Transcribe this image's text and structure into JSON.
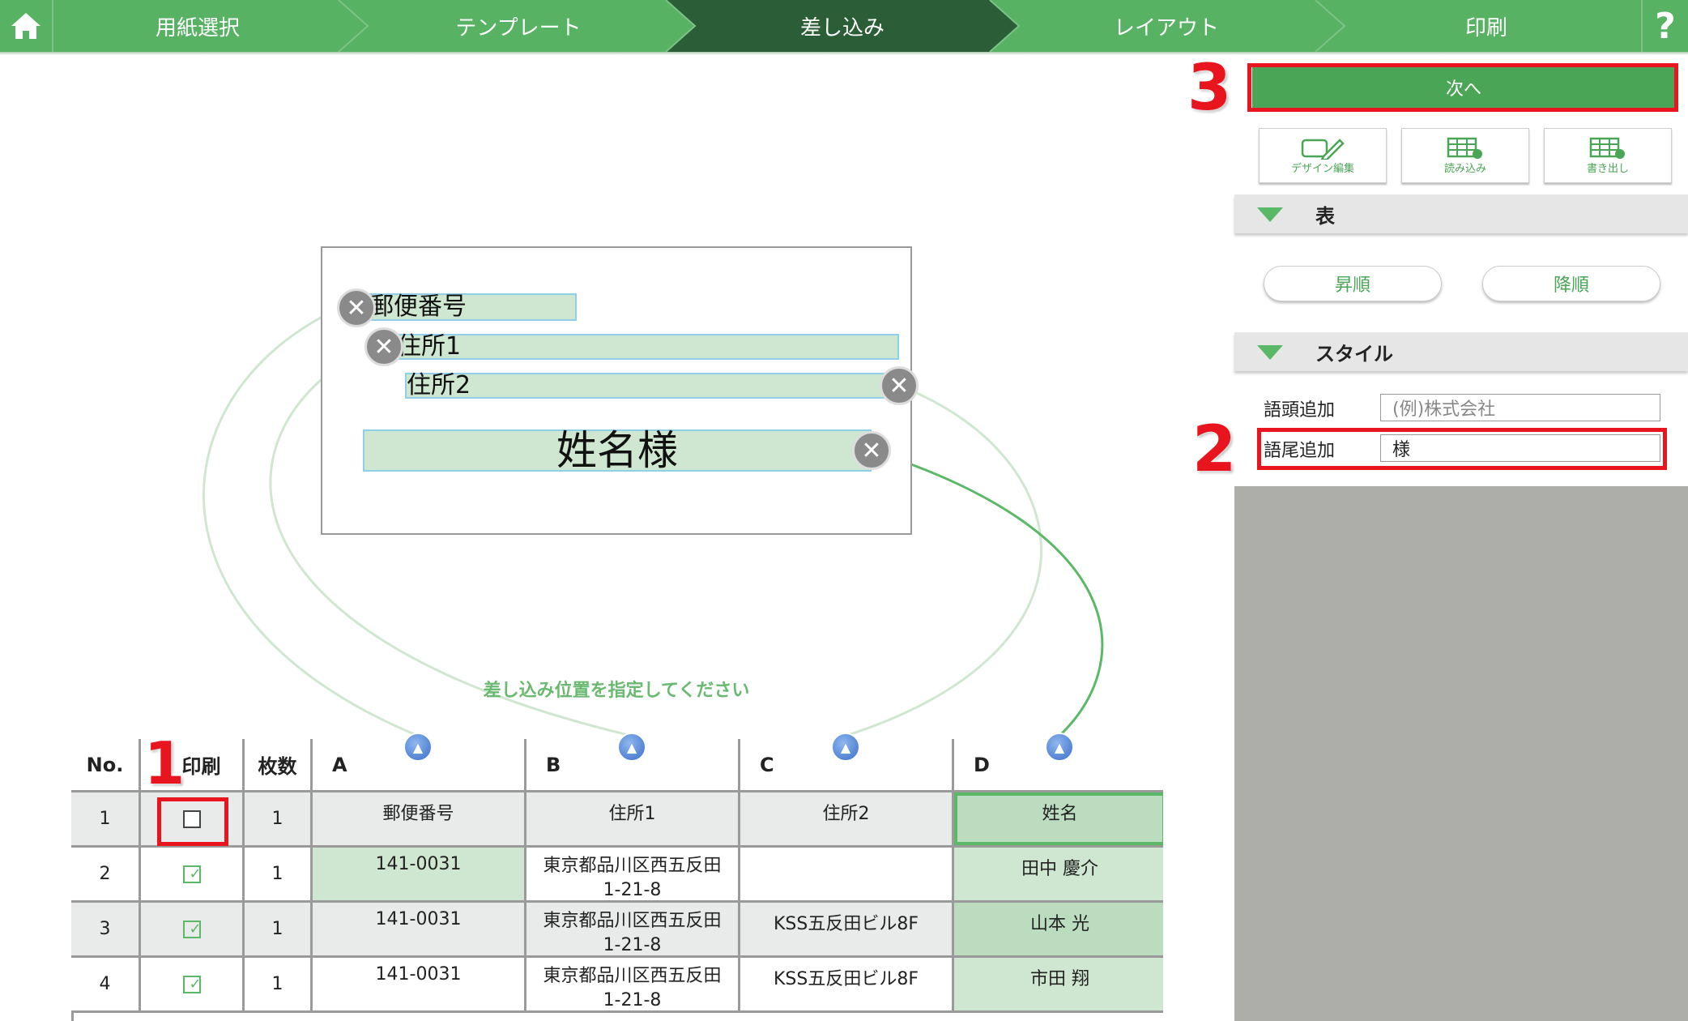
{
  "nav": {
    "steps": [
      {
        "label": "用紙選択"
      },
      {
        "label": "テンプレート"
      },
      {
        "label": "差し込み"
      },
      {
        "label": "レイアウト"
      },
      {
        "label": "印刷"
      }
    ],
    "active_step": "差し込み",
    "help_label": "?"
  },
  "canvas": {
    "fields": {
      "postal": "郵便番号",
      "addr1": "住所1",
      "addr2": "住所2",
      "name": "姓名様"
    },
    "hint": "差し込み位置を指定してください"
  },
  "table": {
    "headers": {
      "no": "No.",
      "print": "印刷",
      "copies": "枚数",
      "a": "A",
      "b": "B",
      "c": "C",
      "d": "D"
    },
    "rows": [
      {
        "no": "1",
        "print": false,
        "copies": "1",
        "a": "郵便番号",
        "b": "住所1",
        "c": "住所2",
        "d": "姓名"
      },
      {
        "no": "2",
        "print": true,
        "copies": "1",
        "a": "141-0031",
        "b": "東京都品川区西五反田1-21-8",
        "c": "",
        "d": "田中 慶介"
      },
      {
        "no": "3",
        "print": true,
        "copies": "1",
        "a": "141-0031",
        "b": "東京都品川区西五反田1-21-8",
        "c": "KSS五反田ビル8F",
        "d": "山本 光"
      },
      {
        "no": "4",
        "print": true,
        "copies": "1",
        "a": "141-0031",
        "b": "東京都品川区西五反田1-21-8",
        "c": "KSS五反田ビル8F",
        "d": "市田 翔"
      }
    ]
  },
  "panel": {
    "next_label": "次へ",
    "tools": [
      {
        "label": "デザイン編集",
        "icon": "design-edit-icon"
      },
      {
        "label": "読み込み",
        "icon": "table-import-icon"
      },
      {
        "label": "書き出し",
        "icon": "table-export-icon"
      }
    ],
    "section_table": "表",
    "sort_asc": "昇順",
    "sort_desc": "降順",
    "section_style": "スタイル",
    "prefix_label": "語頭追加",
    "prefix_placeholder": "(例)株式会社",
    "suffix_label": "語尾追加",
    "suffix_value": "様"
  },
  "callouts": {
    "one": "1",
    "two": "2",
    "three": "3"
  },
  "colors": {
    "nav_green": "#58b264",
    "nav_active": "#2b5e36",
    "accent_green": "#4aa656",
    "callout_red": "#e8141e"
  }
}
